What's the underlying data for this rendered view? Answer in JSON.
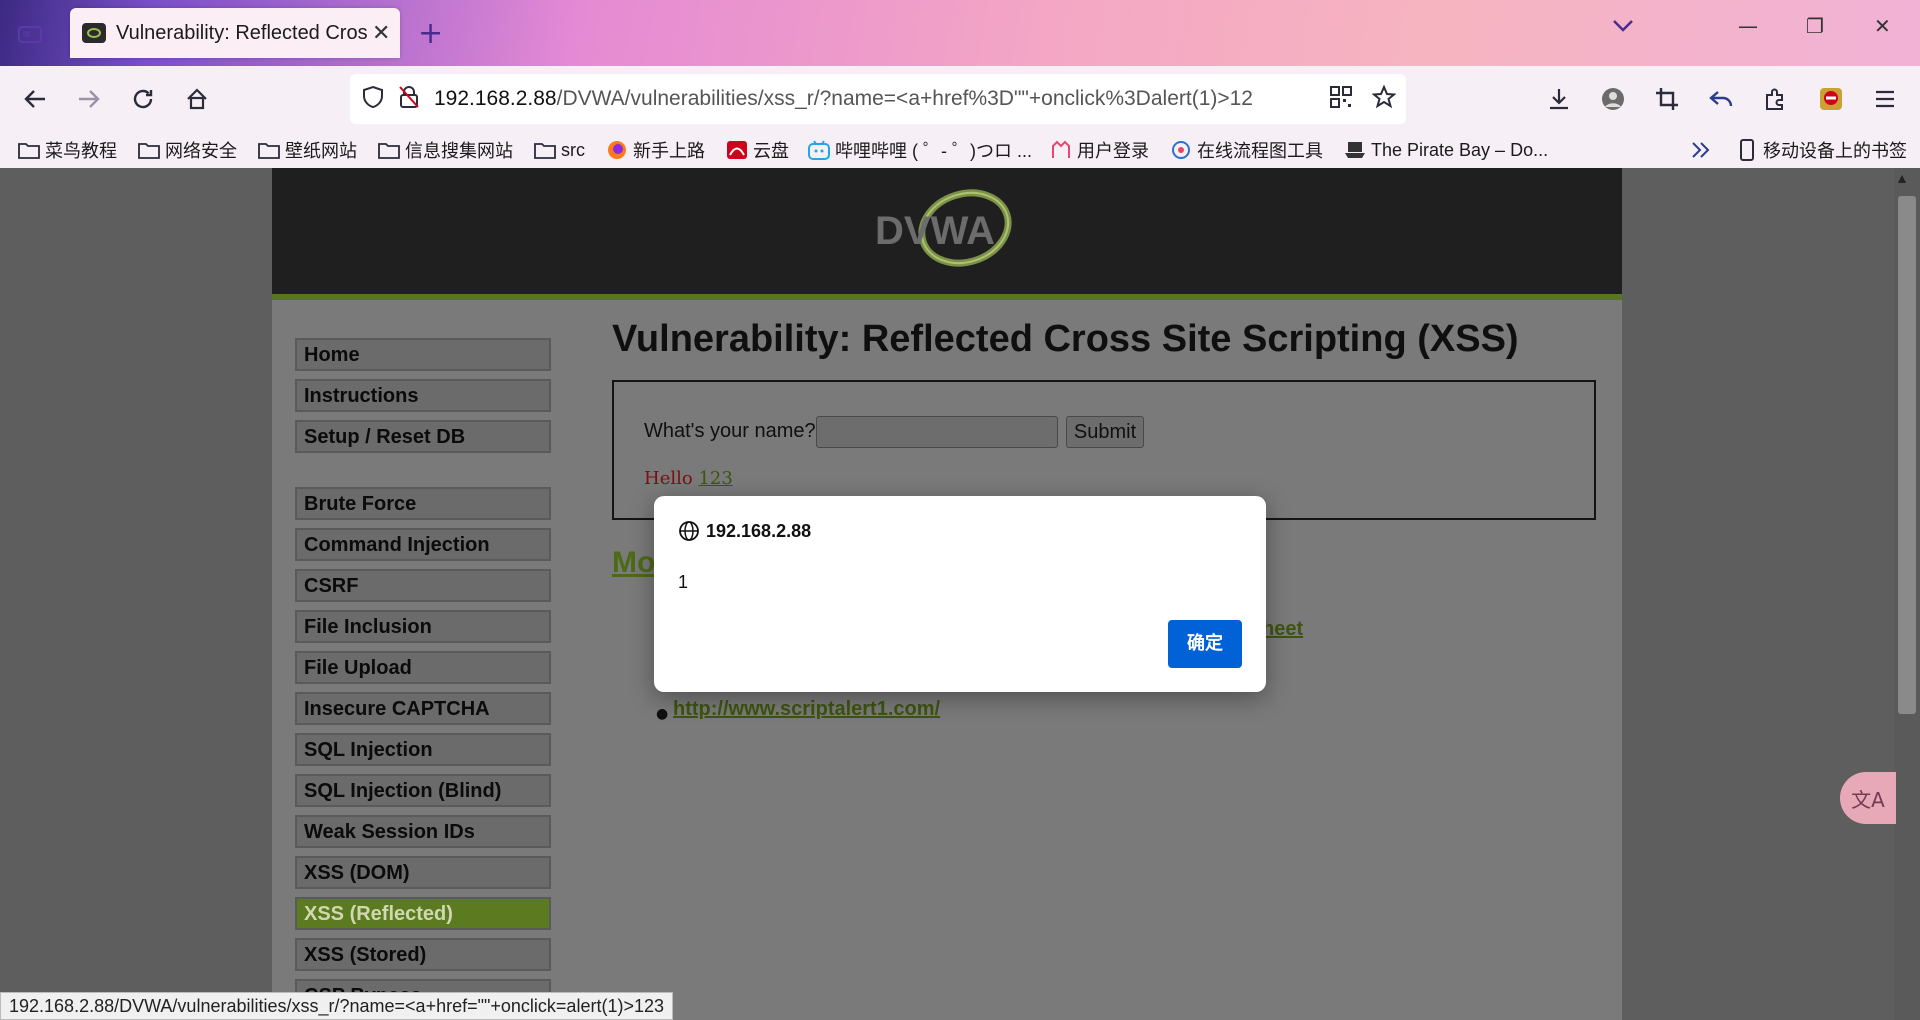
{
  "browser": {
    "tab_title": "Vulnerability: Reflected Cross",
    "url_host": "192.168.2.88",
    "url_path": "/DVWA/vulnerabilities/xss_r/?name=<a+href%3D\"\"+onclick%3Dalert(1)>12",
    "bookmarks": [
      {
        "label": "菜鸟教程",
        "icon": "folder-icon"
      },
      {
        "label": "网络安全",
        "icon": "folder-icon"
      },
      {
        "label": "壁纸网站",
        "icon": "folder-icon"
      },
      {
        "label": "信息搜集网站",
        "icon": "folder-icon"
      },
      {
        "label": "src",
        "icon": "folder-icon"
      },
      {
        "label": "新手上路",
        "icon": "firefox-icon"
      },
      {
        "label": "云盘",
        "icon": "cloud-drive-icon"
      },
      {
        "label": "哔哩哔哩 ( ゜- ゜)つロ ...",
        "icon": "bilibili-icon"
      },
      {
        "label": "用户登录",
        "icon": "user-login-icon"
      },
      {
        "label": "在线流程图工具",
        "icon": "flowchart-icon"
      },
      {
        "label": "The Pirate Bay – Do...",
        "icon": "pirate-ship-icon"
      }
    ],
    "mobile_bookmarks": "移动设备上的书签",
    "status_url": "192.168.2.88/DVWA/vulnerabilities/xss_r/?name=<a+href=\"\"+onclick=alert(1)>123"
  },
  "page": {
    "logo_text": "DVWA",
    "menu_group1": [
      "Home",
      "Instructions",
      "Setup / Reset DB"
    ],
    "menu_group2": [
      "Brute Force",
      "Command Injection",
      "CSRF",
      "File Inclusion",
      "File Upload",
      "Insecure CAPTCHA",
      "SQL Injection",
      "SQL Injection (Blind)",
      "Weak Session IDs",
      "XSS (DOM)",
      "XSS (Reflected)",
      "XSS (Stored)",
      "CSP Bypass"
    ],
    "active_menu_item": "XSS (Reflected)",
    "title": "Vulnerability: Reflected Cross Site Scripting (XSS)",
    "form_label": "What's your name?",
    "submit_label": "Submit",
    "hello_prefix": "Hello",
    "hello_link": "123",
    "more_heading_fragment": "Mo",
    "link_fragment_1": "heet",
    "link_last": "http://www.scriptalert1.com/"
  },
  "dialog": {
    "origin": "192.168.2.88",
    "message": "1",
    "ok_label": "确定"
  },
  "colors": {
    "accent_green": "#59751f",
    "dialog_button": "#0062d6"
  }
}
